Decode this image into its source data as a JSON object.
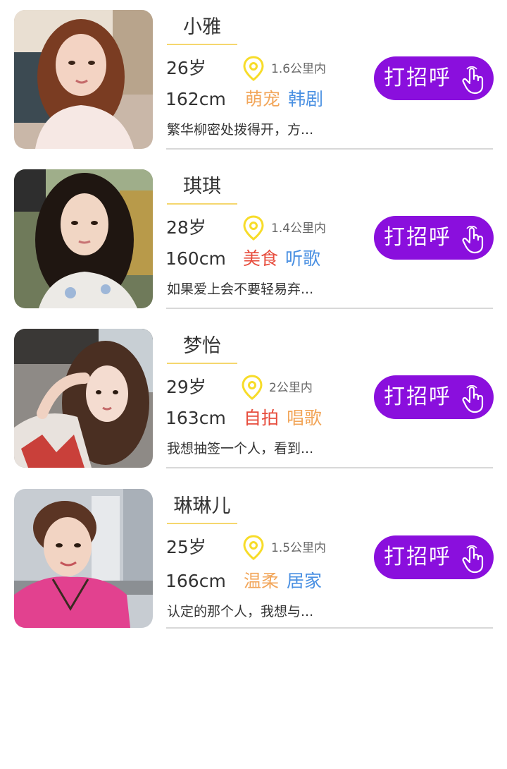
{
  "colors": {
    "accent": "#8a0fdd",
    "underline": "#f5d76e",
    "pin": "#f7dc2a",
    "tag_orange": "#f2a65a",
    "tag_blue": "#4a90e2",
    "tag_red": "#e74c3c",
    "divider": "#d8d8d8"
  },
  "cards": [
    {
      "name": "小雅",
      "age": "26岁",
      "distance": "1.6公里内",
      "height": "162cm",
      "tags": [
        {
          "text": "萌宠",
          "color": "#f2a65a"
        },
        {
          "text": "韩剧",
          "color": "#4a90e2"
        }
      ],
      "intro": "繁华柳密处拨得开，方...",
      "button": "打招呼",
      "avatar_icon": "portrait-photo"
    },
    {
      "name": "琪琪",
      "age": "28岁",
      "distance": "1.4公里内",
      "height": "160cm",
      "tags": [
        {
          "text": "美食",
          "color": "#e74c3c"
        },
        {
          "text": "听歌",
          "color": "#4a90e2"
        }
      ],
      "intro": "如果爱上会不要轻易弃...",
      "button": "打招呼",
      "avatar_icon": "portrait-photo"
    },
    {
      "name": "梦怡",
      "age": "29岁",
      "distance": "2公里内",
      "height": "163cm",
      "tags": [
        {
          "text": "自拍",
          "color": "#e74c3c"
        },
        {
          "text": "唱歌",
          "color": "#f2a65a"
        }
      ],
      "intro": "我想抽签一个人，看到...",
      "button": "打招呼",
      "avatar_icon": "portrait-photo"
    },
    {
      "name": "琳琳儿",
      "age": "25岁",
      "distance": "1.5公里内",
      "height": "166cm",
      "tags": [
        {
          "text": "温柔",
          "color": "#f2a65a"
        },
        {
          "text": "居家",
          "color": "#4a90e2"
        }
      ],
      "intro": "认定的那个人，我想与...",
      "button": "打招呼",
      "avatar_icon": "portrait-photo"
    }
  ]
}
